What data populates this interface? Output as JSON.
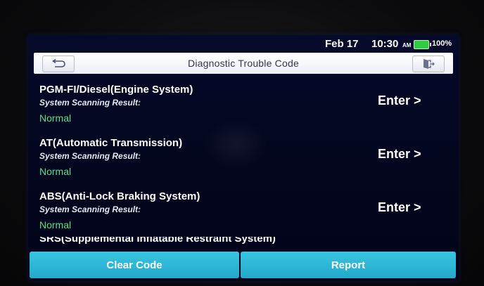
{
  "status_bar": {
    "date": "Feb 17",
    "time": "10:30",
    "ampm": "AM",
    "battery": "100%",
    "battery_color": "#2ecc40"
  },
  "header": {
    "title": "Diagnostic Trouble Code",
    "back_icon": "return-arrow-icon",
    "exit_icon": "exit-door-icon"
  },
  "systems": [
    {
      "name": "PGM-FI/Diesel(Engine System)",
      "scan_label": "System Scanning Result:",
      "status": "Normal",
      "enter_label": "Enter >"
    },
    {
      "name": "AT(Automatic Transmission)",
      "scan_label": "System Scanning Result:",
      "status": "Normal",
      "enter_label": "Enter >"
    },
    {
      "name": "ABS(Anti-Lock Braking System)",
      "scan_label": "System Scanning Result:",
      "status": "Normal",
      "enter_label": "Enter >"
    },
    {
      "name": "SRS(Supplemental Inflatable Restraint System)"
    }
  ],
  "buttons": {
    "clear_code": "Clear Code",
    "report": "Report"
  },
  "colors": {
    "status_normal": "#5ee08a",
    "button_accent": "#2bb5d4",
    "screen_bg": "#03061e"
  }
}
